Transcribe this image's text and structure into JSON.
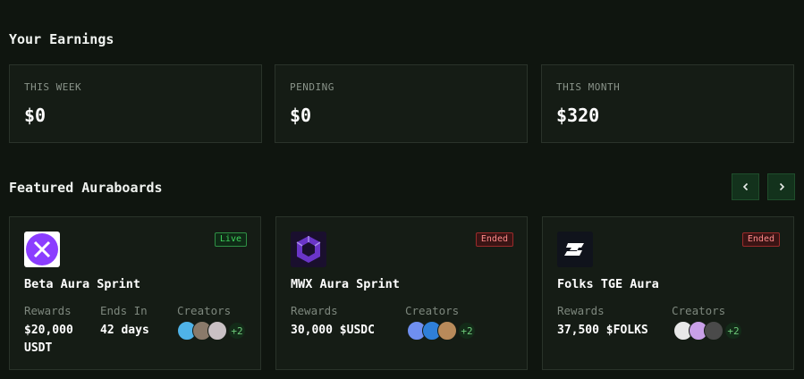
{
  "earnings": {
    "title": "Your Earnings",
    "cards": [
      {
        "label": "THIS WEEK",
        "value": "$0"
      },
      {
        "label": "PENDING",
        "value": "$0"
      },
      {
        "label": "THIS MONTH",
        "value": "$320"
      }
    ]
  },
  "featured": {
    "title": "Featured Auraboards",
    "prev_icon": "chevron-left-icon",
    "next_icon": "chevron-right-icon",
    "boards": [
      {
        "name": "Beta Aura Sprint",
        "status": "Live",
        "rewards_label": "Rewards",
        "rewards_value": "$20,000 USDT",
        "ends_label": "Ends In",
        "ends_value": "42 days",
        "creators_label": "Creators",
        "creators_more": "+2",
        "logo": "beta-logo-icon"
      },
      {
        "name": "MWX Aura Sprint",
        "status": "Ended",
        "rewards_label": "Rewards",
        "rewards_value": "30,000 $USDC",
        "creators_label": "Creators",
        "creators_more": "+2",
        "logo": "mwx-logo-icon"
      },
      {
        "name": "Folks TGE Aura",
        "status": "Ended",
        "rewards_label": "Rewards",
        "rewards_value": "37,500 $FOLKS",
        "creators_label": "Creators",
        "creators_more": "+2",
        "logo": "folks-logo-icon"
      }
    ]
  },
  "colors": {
    "background": "#0f150f",
    "card": "#151c15",
    "live": "#3fd55d",
    "ended": "#ff8a8a"
  }
}
